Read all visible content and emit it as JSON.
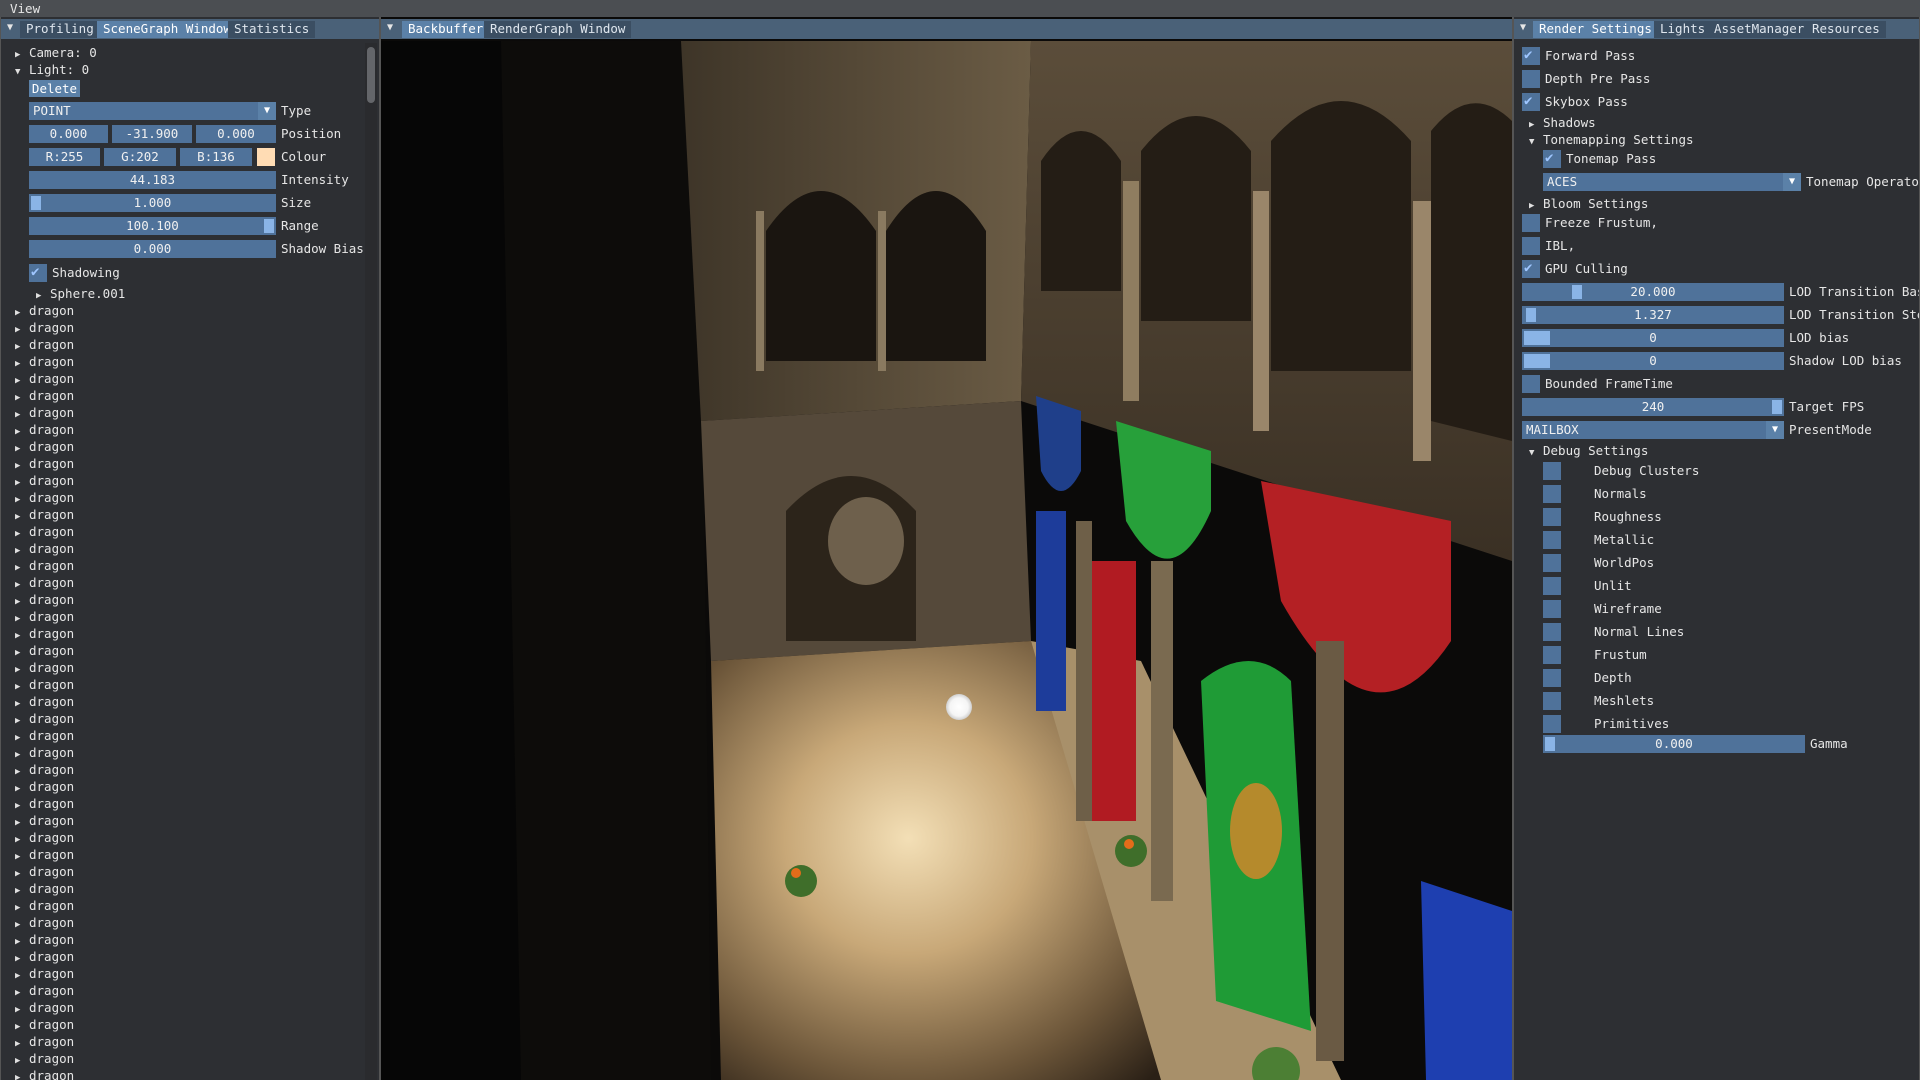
{
  "menubar": {
    "view": "View"
  },
  "left_panel": {
    "tabs": [
      "Profiling",
      "SceneGraph Window",
      "Statistics"
    ],
    "tree": {
      "camera": "Camera: 0",
      "light": "Light: 0",
      "delete_button": "Delete",
      "type_value": "POINT",
      "type_label": "Type",
      "position": {
        "x": "0.000",
        "y": "-31.900",
        "z": "0.000",
        "label": "Position"
      },
      "colour": {
        "r": "R:255",
        "g": "G:202",
        "b": "B:136",
        "label": "Colour",
        "swatch": "#ffdcb4"
      },
      "intensity": {
        "value": "44.183",
        "label": "Intensity"
      },
      "size": {
        "value": "1.000",
        "label": "Size"
      },
      "range": {
        "value": "100.100",
        "label": "Range"
      },
      "shadow_bias": {
        "value": "0.000",
        "label": "Shadow Bias"
      },
      "shadowing": {
        "label": "Shadowing",
        "checked": true
      },
      "sphere": "Sphere.001",
      "dragon_items": [
        "dragon",
        "dragon",
        "dragon",
        "dragon",
        "dragon",
        "dragon",
        "dragon",
        "dragon",
        "dragon",
        "dragon",
        "dragon",
        "dragon",
        "dragon",
        "dragon",
        "dragon",
        "dragon",
        "dragon",
        "dragon",
        "dragon",
        "dragon",
        "dragon",
        "dragon",
        "dragon",
        "dragon",
        "dragon",
        "dragon",
        "dragon",
        "dragon",
        "dragon",
        "dragon",
        "dragon",
        "dragon",
        "dragon",
        "dragon",
        "dragon",
        "dragon",
        "dragon",
        "dragon",
        "dragon",
        "dragon",
        "dragon",
        "dragon",
        "dragon",
        "dragon",
        "dragon",
        "dragon"
      ]
    }
  },
  "center_panel": {
    "tabs": [
      "Backbuffer",
      "RenderGraph Window"
    ]
  },
  "right_panel": {
    "tabs": [
      "Render Settings",
      "Lights",
      "AssetManager",
      "Resources"
    ],
    "forward_pass": "Forward Pass",
    "depth_pre_pass": "Depth Pre Pass",
    "skybox_pass": "Skybox Pass",
    "shadows": "Shadows",
    "tonemapping_settings": "Tonemapping Settings",
    "tonemap_pass": "Tonemap Pass",
    "tonemap_operator_value": "ACES",
    "tonemap_operator_label": "Tonemap Operato",
    "bloom_settings": "Bloom Settings",
    "freeze_frustum": "Freeze Frustum,",
    "ibl": "IBL,",
    "gpu_culling": "GPU Culling",
    "lod_transition_base": {
      "value": "20.000",
      "label": "LOD Transition Bas"
    },
    "lod_transition_step": {
      "value": "1.327",
      "label": "LOD Transition Ste"
    },
    "lod_bias": {
      "value": "0",
      "label": "LOD bias"
    },
    "shadow_lod_bias": {
      "value": "0",
      "label": "Shadow LOD bias"
    },
    "bounded_frametime": "Bounded FrameTime",
    "target_fps": {
      "value": "240",
      "label": "Target FPS"
    },
    "present_mode": {
      "value": "MAILBOX",
      "label": "PresentMode"
    },
    "debug_settings": "Debug Settings",
    "debug_items": [
      "Debug Clusters",
      "Normals",
      "Roughness",
      "Metallic",
      "WorldPos",
      "Unlit",
      "Wireframe",
      "Normal Lines",
      "Frustum",
      "Depth",
      "Meshlets",
      "Primitives"
    ],
    "gamma": {
      "value": "0.000",
      "label": "Gamma"
    }
  }
}
